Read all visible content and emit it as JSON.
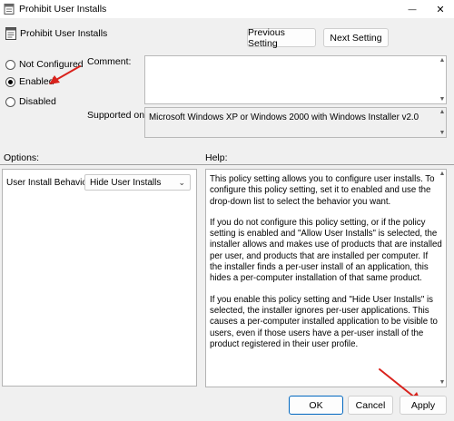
{
  "window": {
    "title": "Prohibit User Installs",
    "minimize_glyph": "—",
    "close_glyph": "✕"
  },
  "header": {
    "title": "Prohibit User Installs",
    "previous_label": "Previous Setting",
    "next_label": "Next Setting"
  },
  "state_options": [
    {
      "label": "Not Configured",
      "checked": false
    },
    {
      "label": "Enabled",
      "checked": true
    },
    {
      "label": "Disabled",
      "checked": false
    }
  ],
  "comment": {
    "label": "Comment:",
    "value": ""
  },
  "supported_on": {
    "label": "Supported on:",
    "value": "Microsoft Windows XP or Windows 2000 with Windows Installer v2.0"
  },
  "options": {
    "label": "Options:",
    "field_label": "User Install Behavior:",
    "selected_value": "Hide User Installs"
  },
  "help": {
    "label": "Help:",
    "paragraphs": [
      "This policy setting allows you to configure user installs. To configure this policy setting, set it to enabled and use the drop-down list to select the behavior you want.",
      "If you do not configure this policy setting, or if the policy setting is enabled and \"Allow User Installs\" is selected, the installer allows and makes use of products that are installed per user, and products that are installed per computer. If the installer finds a per-user install of an application, this hides a per-computer installation of that same product.",
      "If you enable this policy setting and \"Hide User Installs\" is selected, the installer ignores per-user applications. This causes a per-computer installed application to be visible to users, even if those users have a per-user install of the product registered in their user profile."
    ]
  },
  "footer": {
    "ok_label": "OK",
    "cancel_label": "Cancel",
    "apply_label": "Apply"
  },
  "colors": {
    "annotation_arrow": "#d9221c",
    "primary_border": "#0067c0",
    "background": "#f0f0f0"
  }
}
